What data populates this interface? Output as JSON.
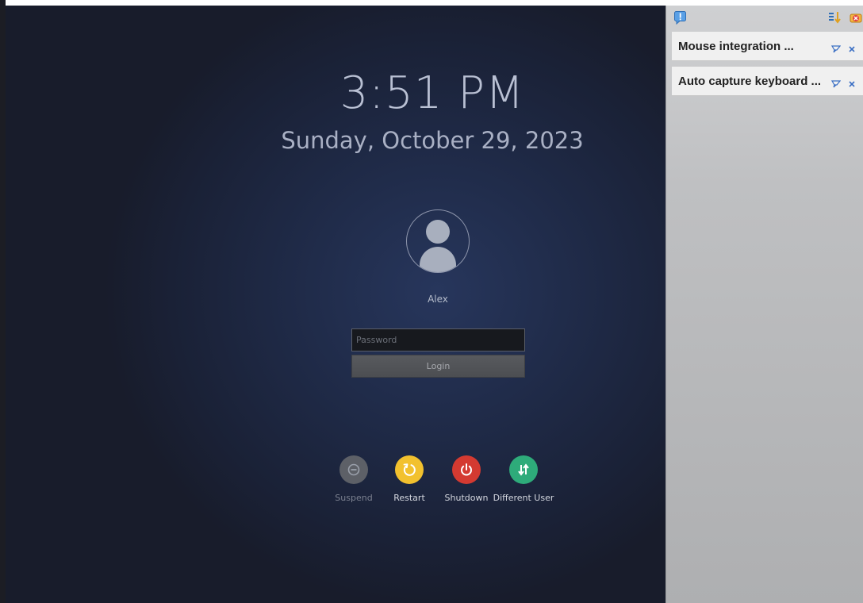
{
  "login_screen": {
    "time": "3:51 PM",
    "date": "Sunday, October 29, 2023",
    "user_name": "Alex",
    "password_placeholder": "Password",
    "login_label": "Login",
    "actions": [
      {
        "label": "Suspend",
        "icon": "suspend-icon",
        "color": "#5d6067"
      },
      {
        "label": "Restart",
        "icon": "restart-icon",
        "color": "#f2c12e"
      },
      {
        "label": "Shutdown",
        "icon": "power-icon",
        "color": "#d43a31"
      },
      {
        "label": "Different User",
        "icon": "switch-user-icon",
        "color": "#2eab7a"
      }
    ]
  },
  "notification_pane": {
    "notifications": [
      {
        "title": "Mouse integration ..."
      },
      {
        "title": "Auto capture keyboard ..."
      }
    ]
  }
}
